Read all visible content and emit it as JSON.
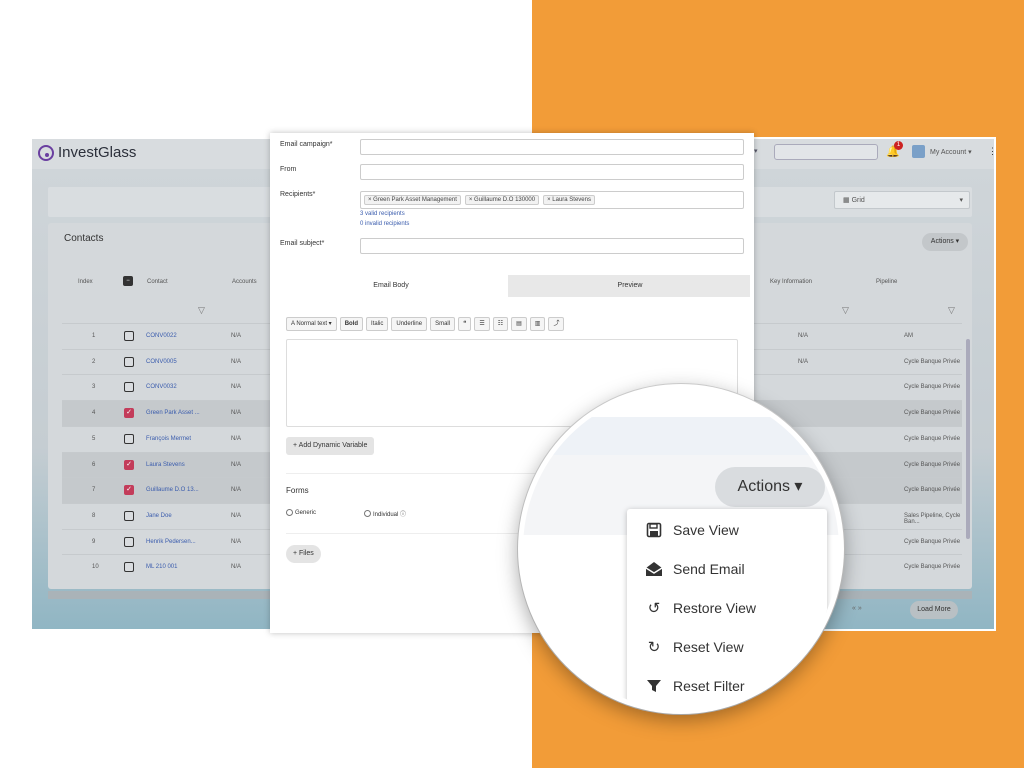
{
  "app": {
    "logo": "InvestGlass",
    "account_label": "My Account",
    "notification_count": "1",
    "grid_label": "Grid",
    "caret": "▾"
  },
  "contacts": {
    "title": "Contacts",
    "actions_label": "Actions ▾",
    "columns": [
      "Index",
      "Contact",
      "Accounts",
      "Key Information",
      "Pipeline"
    ],
    "rows": [
      {
        "index": "1",
        "name": "CONV0022",
        "account": "N/A",
        "key": "N/A",
        "pipeline": "AM",
        "checked": false
      },
      {
        "index": "2",
        "name": "CONV0005",
        "account": "N/A",
        "key": "N/A",
        "pipeline": "Cycle Banque Privée",
        "checked": false
      },
      {
        "index": "3",
        "name": "CONV0032",
        "account": "N/A",
        "key": "",
        "pipeline": "Cycle Banque Privée",
        "checked": false
      },
      {
        "index": "4",
        "name": "Green Park Asset ...",
        "account": "N/A",
        "key": "",
        "pipeline": "Cycle Banque Privée",
        "checked": true
      },
      {
        "index": "5",
        "name": "François Mermet",
        "account": "N/A",
        "key": "",
        "pipeline": "Cycle Banque Privée",
        "checked": false
      },
      {
        "index": "6",
        "name": "Laura Stevens",
        "account": "N/A",
        "key": "",
        "pipeline": "Cycle Banque Privée",
        "checked": true
      },
      {
        "index": "7",
        "name": "Guillaume D.O 13...",
        "account": "N/A",
        "key": "",
        "pipeline": "Cycle Banque Privée",
        "checked": true
      },
      {
        "index": "8",
        "name": "Jane Doe",
        "account": "N/A",
        "key": "",
        "pipeline": "Sales Pipeline, Cycle Ban...",
        "checked": false
      },
      {
        "index": "9",
        "name": "Henrik Pedersen...",
        "account": "N/A",
        "key": "",
        "pipeline": "Cycle Banque Privée",
        "checked": false
      },
      {
        "index": "10",
        "name": "ML 210 001",
        "account": "N/A",
        "key": "",
        "pipeline": "Cycle Banque Privée",
        "checked": false
      }
    ],
    "load_more": "Load More",
    "pager": "«  »"
  },
  "modal": {
    "email_campaign_label": "Email campaign*",
    "from_label": "From",
    "recipients_label": "Recipients*",
    "recipients": [
      "× Green Park Asset Management",
      "× Guillaume D.O 130000",
      "× Laura Stevens"
    ],
    "valid_recipients": "3 valid recipients",
    "invalid_recipients": "0 invalid recipients",
    "subject_label": "Email subject*",
    "tabs": [
      "Email Body",
      "Preview"
    ],
    "toolbar": [
      "A Normal text ▾",
      "Bold",
      "Italic",
      "Underline",
      "Small",
      "❝",
      "☰",
      "☷",
      "▤",
      "▥",
      "⤴"
    ],
    "add_dynamic": "+ Add Dynamic Variable",
    "forms_label": "Forms",
    "radio_generic": "Generic",
    "radio_individual": "Individual ⓘ",
    "files_btn": "+ Files"
  },
  "magnifier": {
    "actions_label": "Actions ▾",
    "menu": [
      {
        "label": "Save View",
        "icon": "floppy-disk-icon"
      },
      {
        "label": "Send Email",
        "icon": "envelope-open-icon"
      },
      {
        "label": "Restore View",
        "icon": "history-icon"
      },
      {
        "label": "Reset View",
        "icon": "refresh-icon"
      },
      {
        "label": "Reset Filter",
        "icon": "filter-icon"
      }
    ]
  },
  "colors": {
    "accent_orange": "#f29c38",
    "link_blue": "#3a5cad",
    "check_red": "#c33c5a"
  }
}
